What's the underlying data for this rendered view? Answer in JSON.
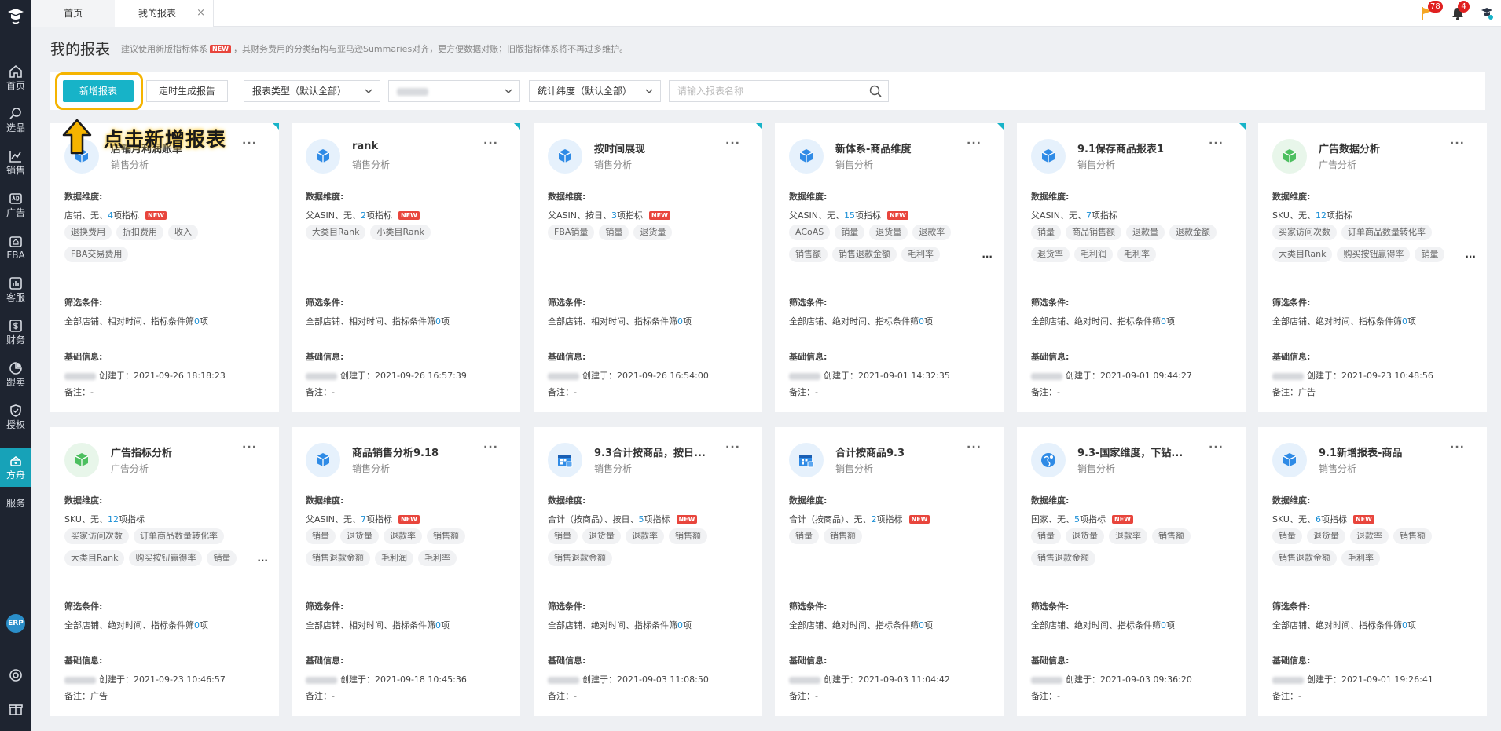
{
  "sidebar": {
    "items": [
      {
        "label": "首页",
        "icon": "home-icon"
      },
      {
        "label": "选品",
        "icon": "search-icon"
      },
      {
        "label": "销售",
        "icon": "chart-icon"
      },
      {
        "label": "广告",
        "icon": "ad-icon"
      },
      {
        "label": "FBA",
        "icon": "warehouse-icon"
      },
      {
        "label": "客服",
        "icon": "report-icon"
      },
      {
        "label": "财务",
        "icon": "dollar-icon"
      },
      {
        "label": "跟卖",
        "icon": "pie-icon"
      },
      {
        "label": "授权",
        "icon": "shield-icon"
      },
      {
        "label": "方舟",
        "icon": "ark-icon"
      },
      {
        "label": "服务",
        "icon": ""
      }
    ],
    "erp_label": "ERP"
  },
  "tabs": {
    "home": "首页",
    "mine": "我的报表",
    "close": "×"
  },
  "topbar": {
    "flag_count": "78",
    "bell_count": "4"
  },
  "header": {
    "title": "我的报表",
    "notice_a": "建议使用新版指标体系",
    "new_tag": "NEW",
    "notice_b": "，其财务费用的分类结构与亚马逊Summaries对齐，更方便数据对账；旧版指标体系将不再过多维护。"
  },
  "toolbar": {
    "add_label": "新增报表",
    "timed_label": "定时生成报告",
    "report_type": "报表类型（默认全部）",
    "stat_dim": "统计纬度（默认全部）",
    "search_placeholder": "请输入报表名称"
  },
  "annotation": {
    "text": "点击新增报表"
  },
  "labels": {
    "dim": "数据维度:",
    "filter": "筛选条件:",
    "basic": "基础信息:",
    "created": "创建于：",
    "remark": "备注：",
    "more": "···",
    "ellipsis": "..."
  },
  "cards": [
    {
      "title": "店铺月利润账单",
      "sub": "销售分析",
      "icon": "cube-icon",
      "icon_color": "#2f8be6",
      "icon_bg": "#e6f1fc",
      "dim_pre": "店铺、无、",
      "dim_num": "4",
      "dim_suf": "项指标",
      "new": "NEW",
      "tags": [
        "退换费用",
        "折扣费用",
        "收入",
        "FBA交易费用"
      ],
      "more_tags": false,
      "filter_pre": "全部店铺、相对时间、指标条件筛",
      "filter_num": "0",
      "filter_suf": "项",
      "created": "2021-09-26 18:18:23",
      "remark": "-"
    },
    {
      "title": "rank",
      "sub": "销售分析",
      "icon": "cube-icon",
      "icon_color": "#2f8be6",
      "icon_bg": "#e6f1fc",
      "dim_pre": "父ASIN、无、",
      "dim_num": "2",
      "dim_suf": "项指标",
      "new": "NEW",
      "tags": [
        "大类目Rank",
        "小类目Rank"
      ],
      "more_tags": false,
      "filter_pre": "全部店铺、相对时间、指标条件筛",
      "filter_num": "0",
      "filter_suf": "项",
      "created": "2021-09-26 16:57:39",
      "remark": "-"
    },
    {
      "title": "按时间展现",
      "sub": "销售分析",
      "icon": "cube-icon",
      "icon_color": "#2f8be6",
      "icon_bg": "#e6f1fc",
      "dim_pre": "父ASIN、按日、",
      "dim_num": "3",
      "dim_suf": "项指标",
      "new": "NEW",
      "tags": [
        "FBA销量",
        "销量",
        "退货量"
      ],
      "more_tags": false,
      "filter_pre": "全部店铺、相对时间、指标条件筛",
      "filter_num": "0",
      "filter_suf": "项",
      "created": "2021-09-26 16:54:00",
      "remark": "-"
    },
    {
      "title": "新体系-商品维度",
      "sub": "销售分析",
      "icon": "cube-icon",
      "icon_color": "#2f8be6",
      "icon_bg": "#e6f1fc",
      "dim_pre": "父ASIN、无、",
      "dim_num": "15",
      "dim_suf": "项指标",
      "new": "NEW",
      "tags": [
        "ACoAS",
        "销量",
        "退货量",
        "退款率",
        "销售额",
        "销售退款金额",
        "毛利率"
      ],
      "more_tags": true,
      "filter_pre": "全部店铺、绝对时间、指标条件筛",
      "filter_num": "0",
      "filter_suf": "项",
      "created": "2021-09-01 14:32:35",
      "remark": "-"
    },
    {
      "title": "9.1保存商品报表1",
      "sub": "销售分析",
      "icon": "cube-icon",
      "icon_color": "#2f8be6",
      "icon_bg": "#e6f1fc",
      "dim_pre": "父ASIN、无、",
      "dim_num": "7",
      "dim_suf": "项指标",
      "new": "",
      "tags": [
        "销量",
        "商品销售额",
        "退款量",
        "退款金额",
        "退货率",
        "毛利润",
        "毛利率"
      ],
      "more_tags": false,
      "filter_pre": "全部店铺、绝对时间、指标条件筛",
      "filter_num": "0",
      "filter_suf": "项",
      "created": "2021-09-01 09:44:27",
      "remark": "-"
    },
    {
      "title": "广告数据分析",
      "sub": "广告分析",
      "icon": "cube-icon",
      "icon_color": "#4cbf5f",
      "icon_bg": "#e8f6ea",
      "dim_pre": "SKU、无、",
      "dim_num": "12",
      "dim_suf": "项指标",
      "new": "",
      "tags": [
        "买家访问次数",
        "订单商品数量转化率",
        "大类目Rank",
        "购买按钮赢得率",
        "销量"
      ],
      "more_tags": true,
      "filter_pre": "全部店铺、绝对时间、指标条件筛",
      "filter_num": "0",
      "filter_suf": "项",
      "created": "2021-09-23 10:48:56",
      "remark": "广告"
    },
    {
      "title": "广告指标分析",
      "sub": "广告分析",
      "icon": "cube-icon",
      "icon_color": "#4cbf5f",
      "icon_bg": "#e8f6ea",
      "dim_pre": "SKU、无、",
      "dim_num": "12",
      "dim_suf": "项指标",
      "new": "",
      "tags": [
        "买家访问次数",
        "订单商品数量转化率",
        "大类目Rank",
        "购买按钮赢得率",
        "销量"
      ],
      "more_tags": true,
      "filter_pre": "全部店铺、绝对时间、指标条件筛",
      "filter_num": "0",
      "filter_suf": "项",
      "created": "2021-09-23 10:46:57",
      "remark": "广告"
    },
    {
      "title": "商品销售分析9.18",
      "sub": "销售分析",
      "icon": "cube-icon",
      "icon_color": "#2f8be6",
      "icon_bg": "#e6f1fc",
      "dim_pre": "父ASIN、无、",
      "dim_num": "7",
      "dim_suf": "项指标",
      "new": "NEW",
      "tags": [
        "销量",
        "退货量",
        "退款率",
        "销售额",
        "销售退款金额",
        "毛利润",
        "毛利率"
      ],
      "more_tags": false,
      "filter_pre": "全部店铺、相对时间、指标条件筛",
      "filter_num": "0",
      "filter_suf": "项",
      "created": "2021-09-18 10:45:36",
      "remark": "-"
    },
    {
      "title": "9.3合计按商品，按日...",
      "sub": "销售分析",
      "icon": "calendar-icon",
      "icon_color": "#2f8be6",
      "icon_bg": "#e6f1fc",
      "dim_pre": "合计（按商品）、按日、",
      "dim_num": "5",
      "dim_suf": "项指标",
      "new": "NEW",
      "tags": [
        "销量",
        "退货量",
        "退款率",
        "销售额",
        "销售退款金额"
      ],
      "more_tags": false,
      "filter_pre": "全部店铺、绝对时间、指标条件筛",
      "filter_num": "0",
      "filter_suf": "项",
      "created": "2021-09-03 11:08:50",
      "remark": "-"
    },
    {
      "title": "合计按商品9.3",
      "sub": "销售分析",
      "icon": "calendar-icon",
      "icon_color": "#2f8be6",
      "icon_bg": "#e6f1fc",
      "dim_pre": "合计（按商品）、无、",
      "dim_num": "2",
      "dim_suf": "项指标",
      "new": "NEW",
      "tags": [
        "销量",
        "销售额"
      ],
      "more_tags": false,
      "filter_pre": "全部店铺、绝对时间、指标条件筛",
      "filter_num": "0",
      "filter_suf": "项",
      "created": "2021-09-03 11:04:42",
      "remark": "-"
    },
    {
      "title": "9.3-国家维度，下钻...",
      "sub": "销售分析",
      "icon": "globe-icon",
      "icon_color": "#2f8be6",
      "icon_bg": "#e6f1fc",
      "dim_pre": "国家、无、",
      "dim_num": "5",
      "dim_suf": "项指标",
      "new": "NEW",
      "tags": [
        "销量",
        "退货量",
        "退款率",
        "销售额",
        "销售退款金额"
      ],
      "more_tags": false,
      "filter_pre": "全部店铺、绝对时间、指标条件筛",
      "filter_num": "0",
      "filter_suf": "项",
      "created": "2021-09-03 09:36:20",
      "remark": "-"
    },
    {
      "title": "9.1新增报表-商品",
      "sub": "销售分析",
      "icon": "cube-icon",
      "icon_color": "#2f8be6",
      "icon_bg": "#e6f1fc",
      "dim_pre": "SKU、无、",
      "dim_num": "6",
      "dim_suf": "项指标",
      "new": "NEW",
      "tags": [
        "销量",
        "退货量",
        "退款率",
        "销售额",
        "销售退款金额",
        "毛利率"
      ],
      "more_tags": false,
      "filter_pre": "全部店铺、绝对时间、指标条件筛",
      "filter_num": "0",
      "filter_suf": "项",
      "created": "2021-09-01 19:26:41",
      "remark": "-"
    }
  ]
}
